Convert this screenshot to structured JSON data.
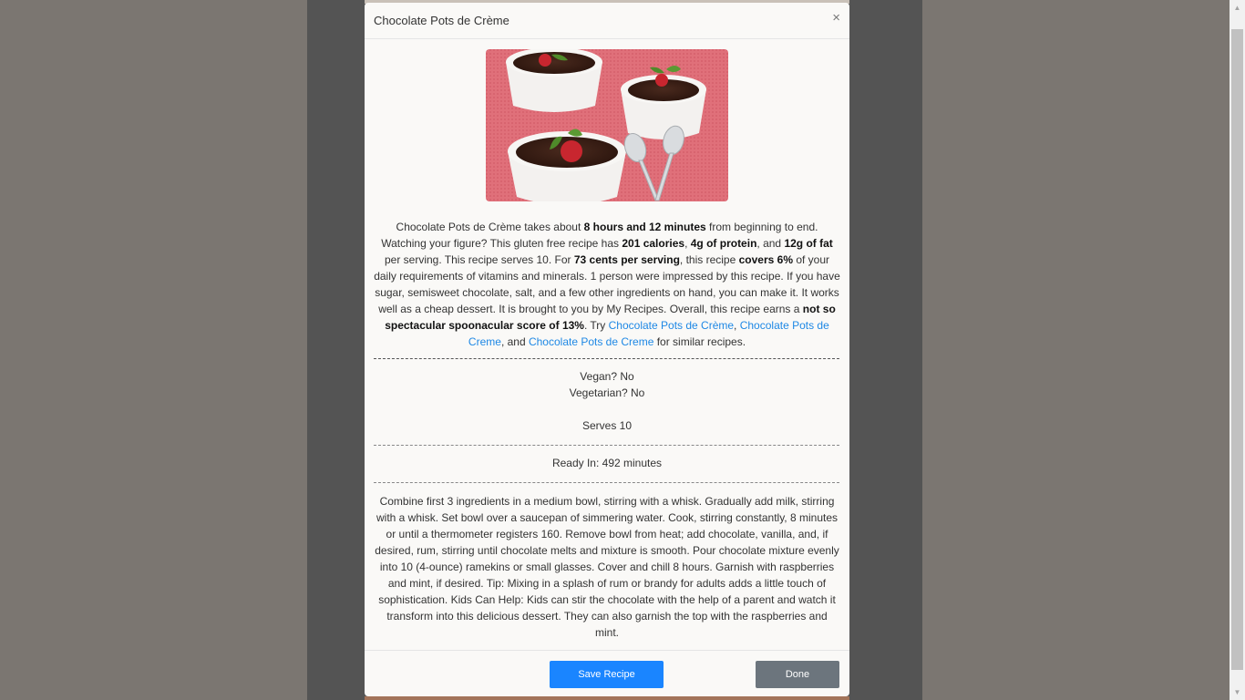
{
  "modal": {
    "title": "Chocolate Pots de Crème",
    "close_icon": "×"
  },
  "summary": {
    "p1": "Chocolate Pots de Crème takes about ",
    "b1": "8 hours and 12 minutes",
    "p2": " from beginning to end. Watching your figure? This gluten free recipe has ",
    "b2": "201 calories",
    "p3": ", ",
    "b3": "4g of protein",
    "p4": ", and ",
    "b4": "12g of fat",
    "p5": " per serving. This recipe serves 10. For ",
    "b5": "73 cents per serving",
    "p6": ", this recipe ",
    "b6": "covers 6%",
    "p7": " of your daily requirements of vitamins and minerals. 1 person were impressed by this recipe. If you have sugar, semisweet chocolate, salt, and a few other ingredients on hand, you can make it. It works well as a cheap dessert. It is brought to you by My Recipes. Overall, this recipe earns a ",
    "b7": "not so spectacular spoonacular score of 13%",
    "p8": ". Try ",
    "link1": "Chocolate Pots de Crème",
    "p9": ", ",
    "link2": "Chocolate Pots de Creme",
    "p10": ", and ",
    "link3": "Chocolate Pots de Creme",
    "p11": " for similar recipes."
  },
  "diet": {
    "vegan": "Vegan? No",
    "vegetarian": "Vegetarian? No",
    "serves": "Serves 10"
  },
  "ready_in": "Ready In: 492 minutes",
  "instructions": "Combine first 3 ingredients in a medium bowl, stirring with a whisk. Gradually add milk, stirring with a whisk. Set bowl over a saucepan of simmering water. Cook, stirring constantly, 8 minutes or until a thermometer registers 160. Remove bowl from heat; add chocolate, vanilla, and, if desired, rum, stirring until chocolate melts and mixture is smooth. Pour chocolate mixture evenly into 10 (4-ounce) ramekins or small glasses. Cover and chill 8 hours. Garnish with raspberries and mint, if desired. Tip: Mixing in a splash of rum or brandy for adults adds a little touch of sophistication. Kids Can Help: Kids can stir the chocolate with the help of a parent and watch it transform into this delicious dessert. They can also garnish the top with the raspberries and mint.",
  "footer": {
    "save_label": "Save Recipe",
    "done_label": "Done"
  },
  "colors": {
    "primary": "#1a85ff",
    "secondary": "#6c757d",
    "link": "#1e88e5"
  }
}
